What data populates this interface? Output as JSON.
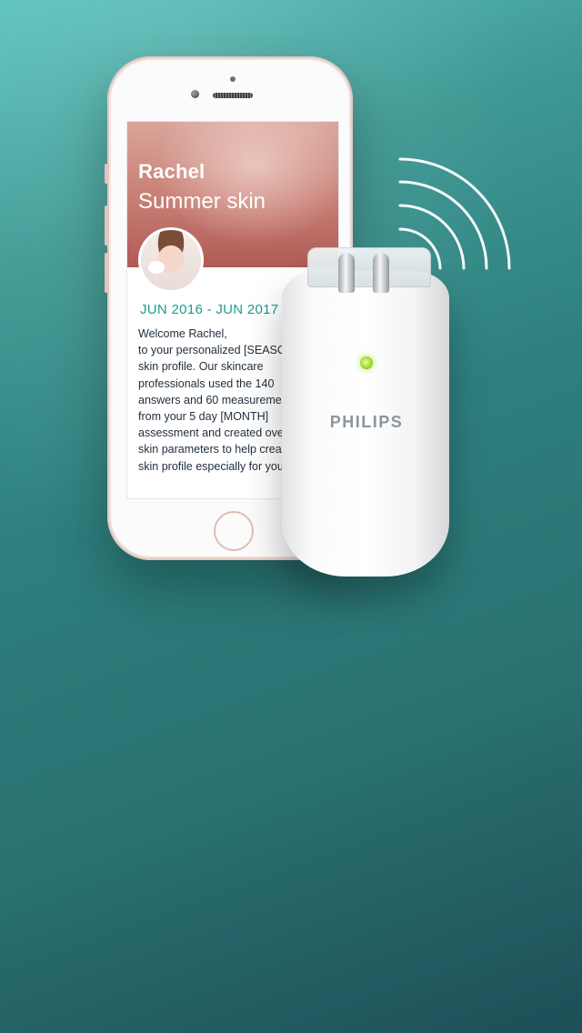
{
  "profile": {
    "name": "Rachel",
    "subtitle": "Summer skin",
    "date_range": "JUN 2016 - JUN 2017",
    "welcome_text": "Welcome Rachel,\nto your personalized [SEASON]\nskin profile. Our skincare\nprofessionals used the 140\nanswers and 60 measurements\nfrom your 5 day [MONTH]\nassessment and created over\nskin parameters to help create\nskin profile especially for you."
  },
  "device": {
    "brand": "PHILIPS",
    "led_color": "#9bd42b"
  },
  "colors": {
    "background_top": "#5cc3bd",
    "background_bottom": "#1d4f57",
    "accent_teal": "#1a9e8f",
    "phone_rose_gold": "#f1e2de"
  },
  "icons": {
    "wireless": "wireless-signal-icon"
  }
}
